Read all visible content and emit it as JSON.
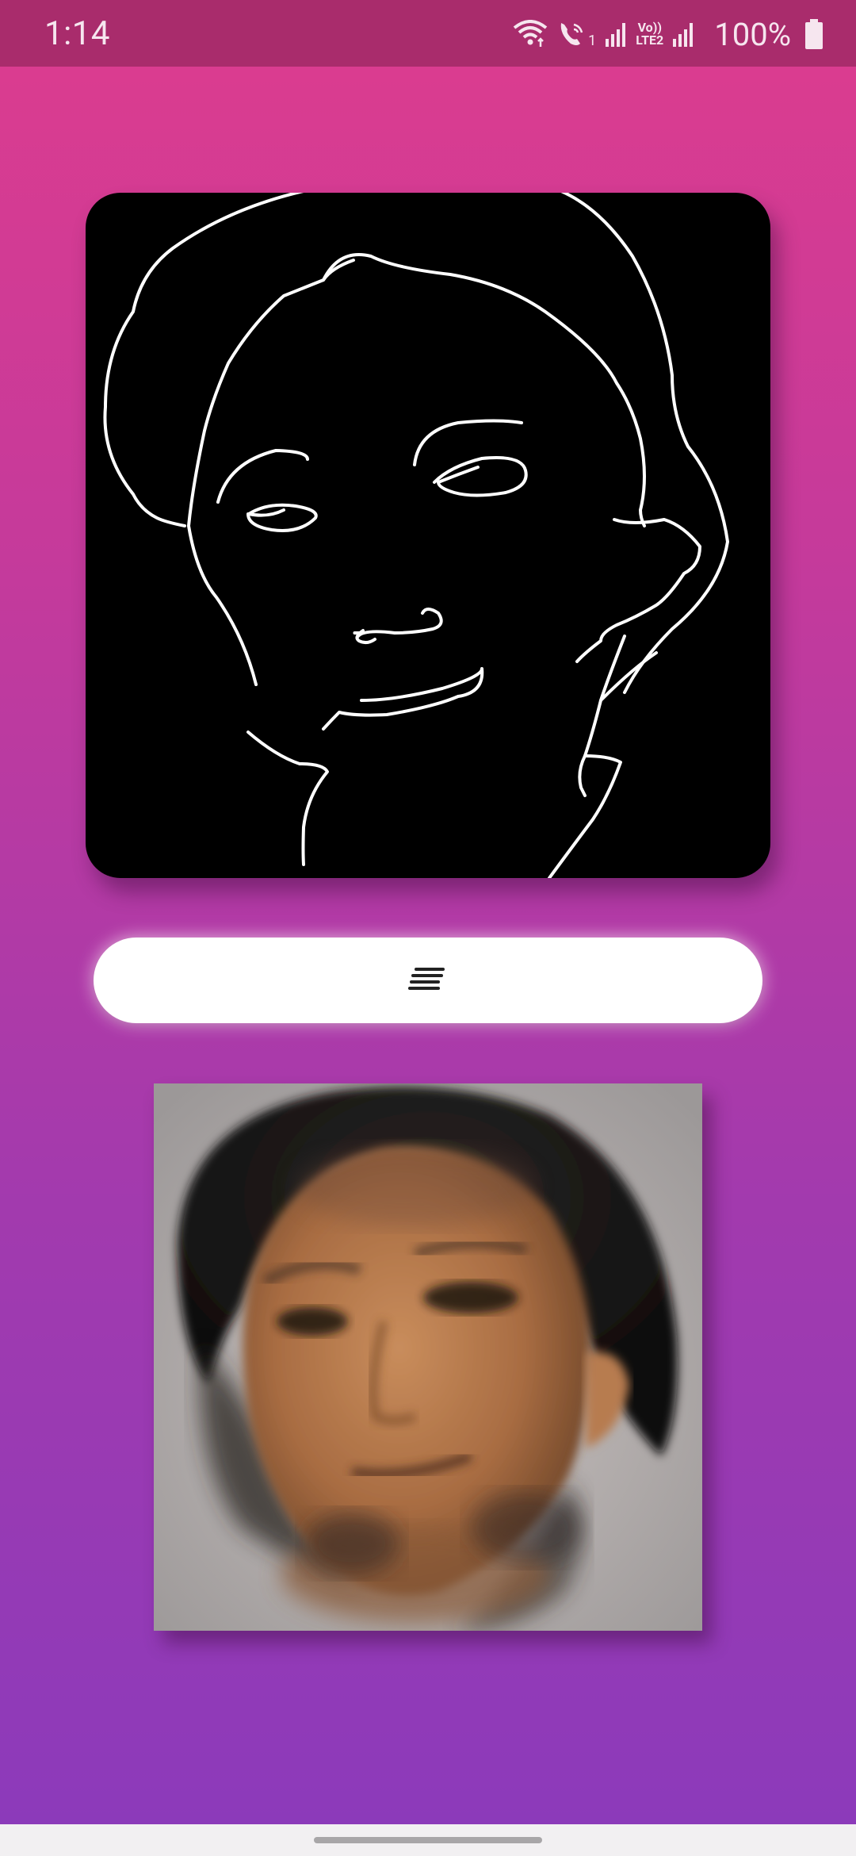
{
  "status_bar": {
    "time": "1:14",
    "battery": "100%",
    "lte_line1": "Vo))",
    "lte_line2": "LTE2",
    "call_sim": "1",
    "icons": [
      "wifi-calling-icon",
      "volte-call-icon",
      "signal-icon",
      "battery-icon"
    ]
  },
  "sketch": {
    "icon": "sketch-canvas",
    "stroke_color": "#FFFFFF",
    "background": "#000000"
  },
  "generate_button": {
    "icon": "short-text-icon"
  },
  "result": {
    "icon": "generated-face-image"
  },
  "colors": {
    "gradient_top": "#DD3C8E",
    "gradient_bottom": "#8B3ABB",
    "status_bar": "#A92C6C"
  }
}
